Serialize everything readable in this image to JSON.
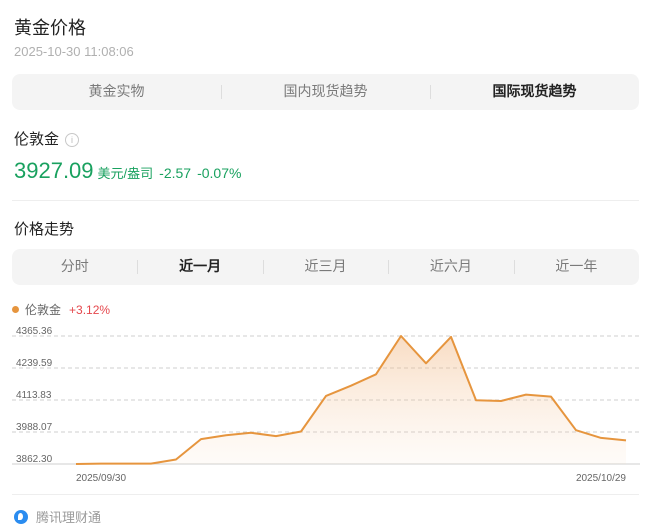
{
  "header": {
    "title": "黄金价格",
    "timestamp": "2025-10-30 11:08:06"
  },
  "market_tabs": [
    {
      "label": "黄金实物",
      "active": false
    },
    {
      "label": "国内现货趋势",
      "active": false
    },
    {
      "label": "国际现货趋势",
      "active": true
    }
  ],
  "quote": {
    "name": "伦敦金",
    "price": "3927.09",
    "unit": "美元/盎司",
    "change": "-2.57",
    "change_pct": "-0.07%",
    "color": "#19a15f"
  },
  "trend": {
    "section_title": "价格走势",
    "range_tabs": [
      {
        "label": "分时",
        "active": false
      },
      {
        "label": "近一月",
        "active": true
      },
      {
        "label": "近三月",
        "active": false
      },
      {
        "label": "近六月",
        "active": false
      },
      {
        "label": "近一年",
        "active": false
      }
    ],
    "legend_name": "伦敦金",
    "legend_change": "+3.12%"
  },
  "chart_data": {
    "type": "area",
    "series": [
      {
        "name": "伦敦金",
        "color": "#e6953e",
        "values": [
          3862.3,
          3864,
          3864,
          3864,
          3880,
          3960,
          3975,
          3985,
          3972,
          3990,
          4130,
          4170,
          4215,
          4365.36,
          4258,
          4362,
          4113,
          4110,
          4135,
          4127,
          3995,
          3965,
          3955
        ]
      }
    ],
    "x_start_label": "2025/09/30",
    "x_end_label": "2025/10/29",
    "y_ticks": [
      "3862.30",
      "3988.07",
      "4113.83",
      "4239.59",
      "4365.36"
    ],
    "ylim": [
      3862.3,
      4365.36
    ],
    "grid": true
  },
  "footer": {
    "source": "腾讯理财通"
  }
}
